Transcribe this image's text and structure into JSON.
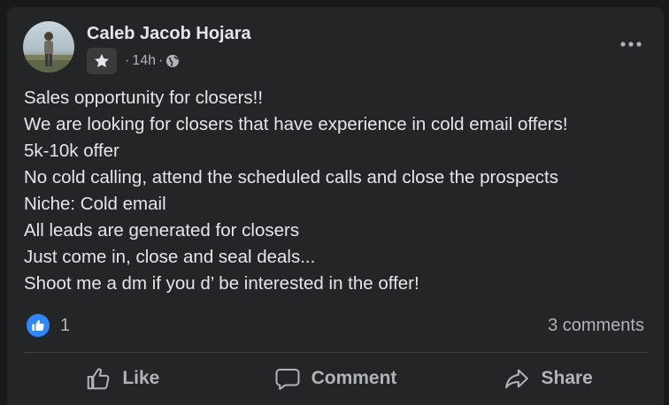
{
  "post": {
    "author_name": "Caleb Jacob Hojara",
    "timestamp": "14h",
    "separator": "·",
    "badge_icon": "star-icon",
    "audience_icon": "globe-icon",
    "body_lines": [
      "Sales opportunity for closers!!",
      "We are looking for closers that have experience in cold email offers!",
      "5k-10k offer",
      "No cold calling, attend the scheduled calls and close the prospects",
      "Niche: Cold email",
      "All leads are generated for closers",
      "Just come in, close and seal deals...",
      "Shoot me a dm if you d’ be interested in the offer!"
    ]
  },
  "stats": {
    "reaction_icon": "like-reaction-icon",
    "reaction_count": "1",
    "comments_label": "3 comments"
  },
  "actions": {
    "like_label": "Like",
    "comment_label": "Comment",
    "share_label": "Share"
  },
  "colors": {
    "page_bg": "#18191a",
    "card_bg": "#242526",
    "primary_text": "#e4e6eb",
    "secondary_text": "#b0b3b8",
    "accent_blue": "#2d88ff"
  }
}
